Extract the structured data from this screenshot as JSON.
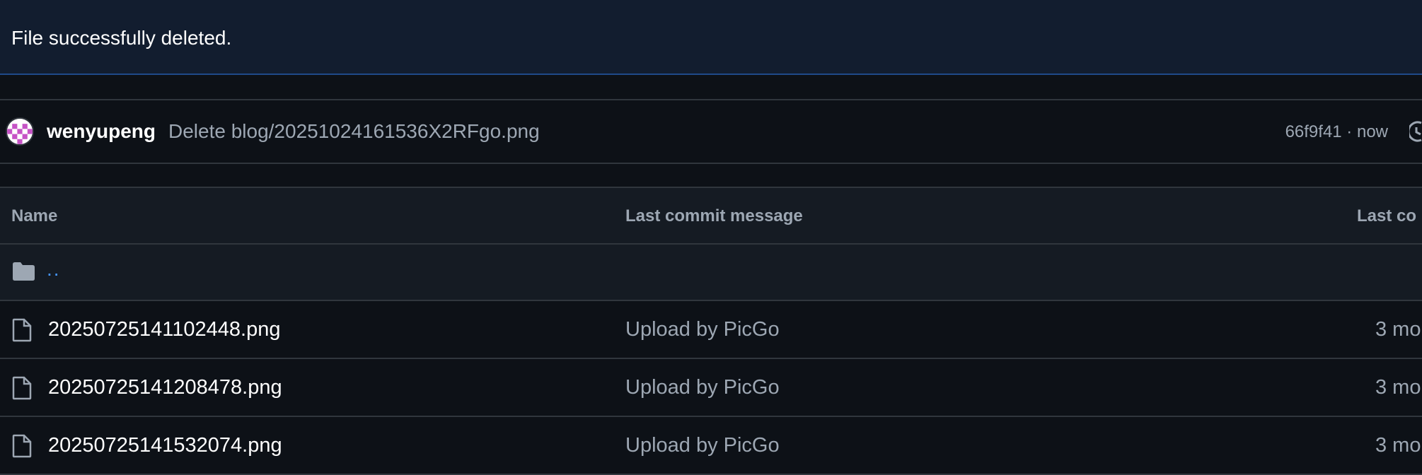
{
  "flash": {
    "message": "File successfully deleted."
  },
  "commit": {
    "author": "wenyupeng",
    "message": "Delete blog/20251024161536X2RFgo.png",
    "meta": "66f9f41 · now",
    "avatar_icon": "identicon-avatar",
    "history_icon": "history-icon"
  },
  "table": {
    "columns": {
      "name": "Name",
      "message": "Last commit message",
      "date": "Last co"
    },
    "parent": {
      "label": "..",
      "icon": "folder-icon"
    },
    "rows": [
      {
        "name": "20250725141102448.png",
        "message": "Upload by PicGo",
        "date": "3 mo",
        "icon": "file-icon"
      },
      {
        "name": "20250725141208478.png",
        "message": "Upload by PicGo",
        "date": "3 mo",
        "icon": "file-icon"
      },
      {
        "name": "20250725141532074.png",
        "message": "Upload by PicGo",
        "date": "3 mo",
        "icon": "file-icon"
      }
    ]
  },
  "colors": {
    "background": "#0d1117",
    "flash_background": "#121d2f",
    "accent": "#4493f8",
    "muted_text": "#9da7b3",
    "border": "#30363d"
  }
}
